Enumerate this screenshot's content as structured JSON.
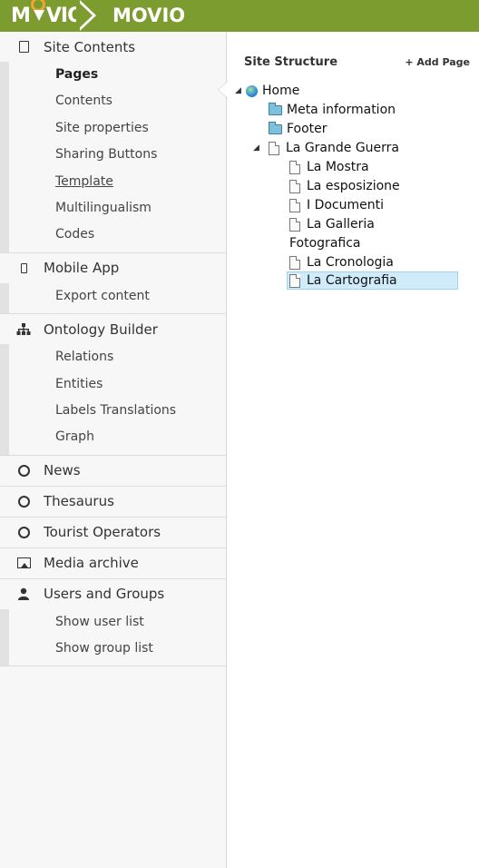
{
  "header": {
    "logo_left": "M",
    "logo_right": "VIO",
    "app_title": "MOVIO",
    "brand_color": "#7d9c30",
    "logo_accent": "#f0a62b"
  },
  "sidebar": {
    "sections": [
      {
        "label": "Site Contents",
        "icon": "page-icon",
        "items": [
          "Pages",
          "Contents",
          "Site properties",
          "Sharing Buttons",
          "Template",
          "Multilingualism",
          "Codes"
        ],
        "active": "Pages"
      },
      {
        "label": "Mobile App",
        "icon": "mobile-icon",
        "items": [
          "Export content"
        ]
      },
      {
        "label": "Ontology Builder",
        "icon": "sitemap-icon",
        "items": [
          "Relations",
          "Entities",
          "Labels Translations",
          "Graph"
        ]
      },
      {
        "label": "News",
        "icon": "circle-icon",
        "items": []
      },
      {
        "label": "Thesaurus",
        "icon": "circle-icon",
        "items": []
      },
      {
        "label": "Tourist Operators",
        "icon": "circle-icon",
        "items": []
      },
      {
        "label": "Media archive",
        "icon": "image-icon",
        "items": []
      },
      {
        "label": "Users and Groups",
        "icon": "user-icon",
        "items": [
          "Show user list",
          "Show group list"
        ]
      }
    ]
  },
  "main": {
    "title": "Site Structure",
    "add_page": "+ Add Page",
    "tree": [
      {
        "label": "Home",
        "type": "globe",
        "level": 0,
        "expanded": true
      },
      {
        "label": "Meta information",
        "type": "folder",
        "level": 1
      },
      {
        "label": "Footer",
        "type": "folder",
        "level": 1
      },
      {
        "label": "La Grande Guerra",
        "type": "doc",
        "level": 1,
        "expanded": true
      },
      {
        "label": "La Mostra",
        "type": "doc",
        "level": 2
      },
      {
        "label": "La esposizione",
        "type": "doc",
        "level": 2
      },
      {
        "label": "I Documenti",
        "type": "doc",
        "level": 2
      },
      {
        "label": "La Galleria",
        "type": "doc",
        "level": 2
      },
      {
        "label": "Fotografica",
        "type": "text",
        "level": 2
      },
      {
        "label": "La Cronologia",
        "type": "doc",
        "level": 2
      },
      {
        "label": "La Cartografia",
        "type": "doc",
        "level": 2,
        "selected": true
      }
    ]
  }
}
